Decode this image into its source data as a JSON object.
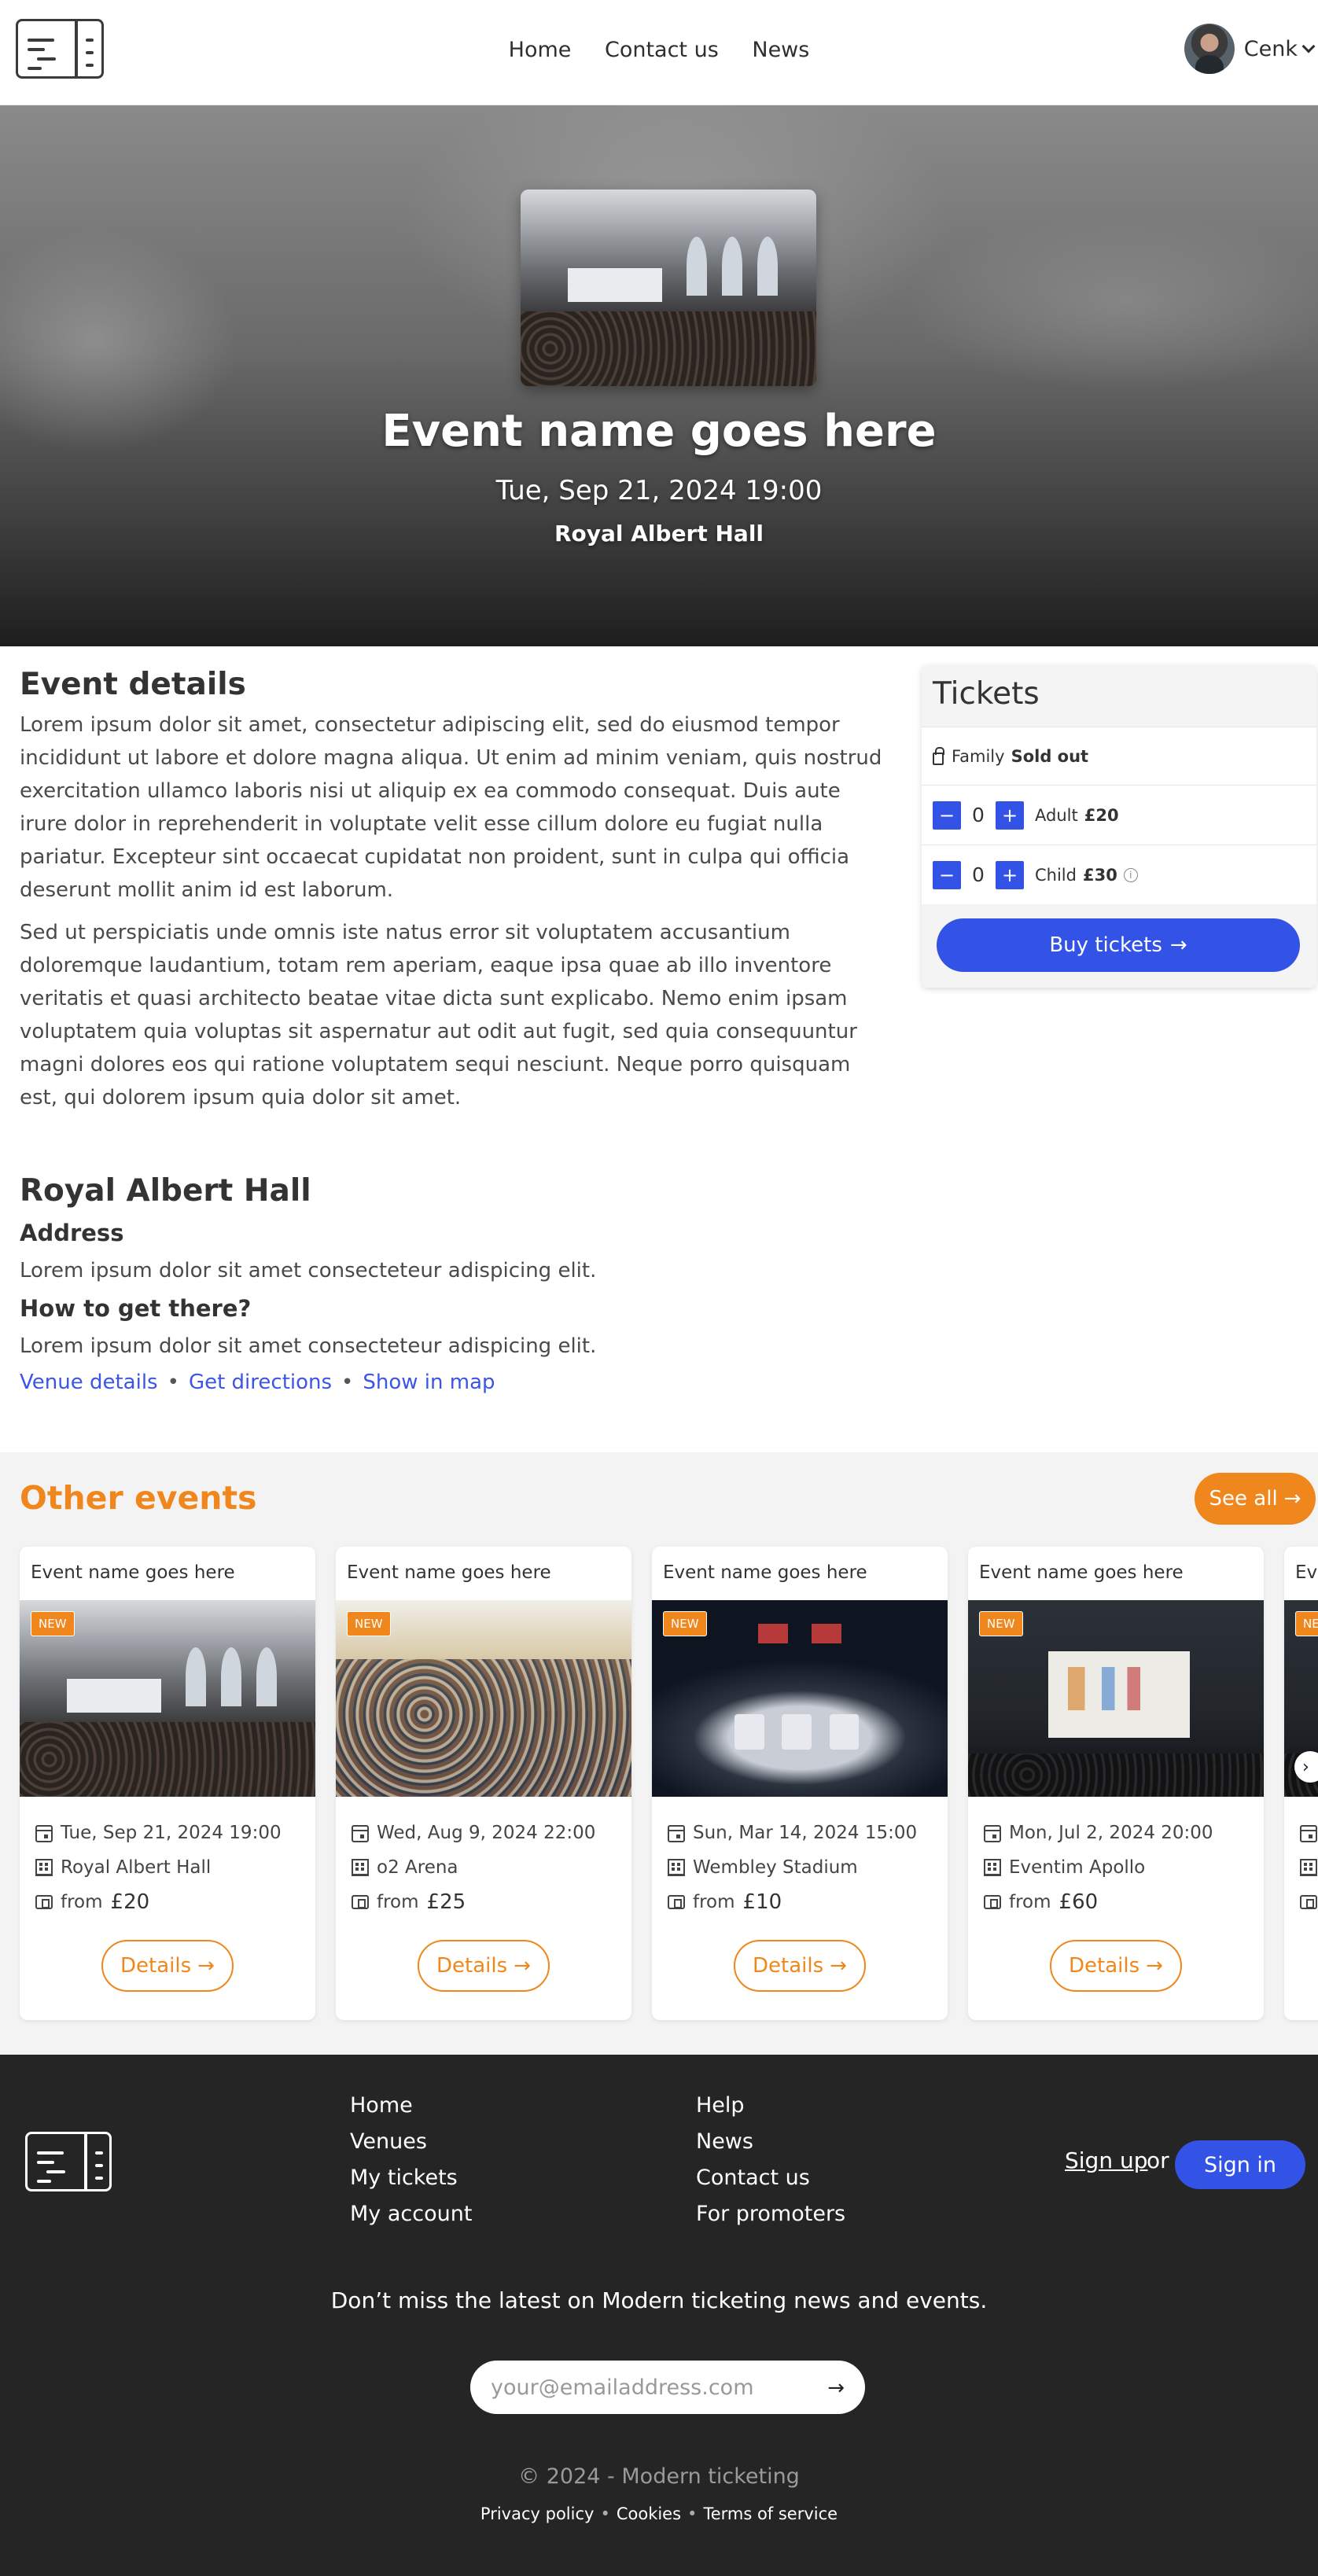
{
  "header": {
    "nav": [
      "Home",
      "Contact us",
      "News"
    ],
    "user_name": "Cenk"
  },
  "hero": {
    "title": "Event name goes here",
    "date": "Tue, Sep 21, 2024 19:00",
    "venue": "Royal Albert Hall"
  },
  "details": {
    "heading": "Event details",
    "p1": "Lorem ipsum dolor sit amet, consectetur adipiscing elit, sed do eiusmod tempor incididunt ut labore et dolore magna aliqua. Ut enim ad minim veniam, quis nostrud exercitation ullamco laboris nisi ut aliquip ex ea commodo consequat. Duis aute irure dolor in reprehenderit in voluptate velit esse cillum dolore eu fugiat nulla pariatur. Excepteur sint occaecat cupidatat non proident, sunt in culpa qui officia deserunt mollit anim id est laborum.",
    "p2": "Sed ut perspiciatis unde omnis iste natus error sit voluptatem accusantium doloremque laudantium, totam rem aperiam, eaque ipsa quae ab illo inventore veritatis et quasi architecto beatae vitae dicta sunt explicabo. Nemo enim ipsam voluptatem quia voluptas sit aspernatur aut odit aut fugit, sed quia consequuntur magni dolores eos qui ratione voluptatem sequi nesciunt. Neque porro quisquam est, qui dolorem ipsum quia dolor sit amet."
  },
  "venue": {
    "name": "Royal Albert Hall",
    "address_heading": "Address",
    "address_text": "Lorem ipsum dolor sit amet consecteteur adispicing elit.",
    "directions_heading": "How to get there?",
    "directions_text": "Lorem ipsum dolor sit amet consecteteur adispicing elit.",
    "links": [
      "Venue details",
      "Get directions",
      "Show in map"
    ]
  },
  "tickets": {
    "heading": "Tickets",
    "family": {
      "label": "Family",
      "status": "Sold out"
    },
    "adult": {
      "qty": "0",
      "label": "Adult",
      "price": "£20"
    },
    "child": {
      "qty": "0",
      "label": "Child",
      "price": "£30"
    },
    "minus": "−",
    "plus": "+",
    "buy_label": "Buy tickets",
    "arrow": "→"
  },
  "other_events": {
    "heading": "Other events",
    "see_all": "See all",
    "details_label": "Details",
    "from_label": "from",
    "badge": "NEW",
    "cards": [
      {
        "title": "Event name goes here",
        "date": "Tue, Sep 21, 2024 19:00",
        "venue": "Royal Albert Hall",
        "price": "£20"
      },
      {
        "title": "Event name goes here",
        "date": "Wed, Aug 9, 2024 22:00",
        "venue": "o2 Arena",
        "price": "£25"
      },
      {
        "title": "Event name goes here",
        "date": "Sun, Mar 14, 2024 15:00",
        "venue": "Wembley Stadium",
        "price": "£10"
      },
      {
        "title": "Event name goes here",
        "date": "Mon, Jul 2, 2024 20:00",
        "venue": "Eventim Apollo",
        "price": "£60"
      },
      {
        "title": "Event name goes here",
        "date": "",
        "venue": "",
        "price": ""
      }
    ]
  },
  "footer": {
    "col1": [
      "Home",
      "Venues",
      "My tickets",
      "My account"
    ],
    "col2": [
      "Help",
      "News",
      "Contact us",
      "For promoters"
    ],
    "sign_up": "Sign up",
    "or": "or",
    "sign_in": "Sign in",
    "newsletter": "Don’t miss the latest on Modern ticketing news and events.",
    "email_placeholder": "your@emailaddress.com",
    "copyright": "© 2024 - Modern ticketing",
    "legal": [
      "Privacy policy",
      "Cookies",
      "Terms of service"
    ]
  },
  "colors": {
    "primary_blue": "#3352e6",
    "accent_orange": "#f0871d",
    "footer_bg": "#252525"
  }
}
